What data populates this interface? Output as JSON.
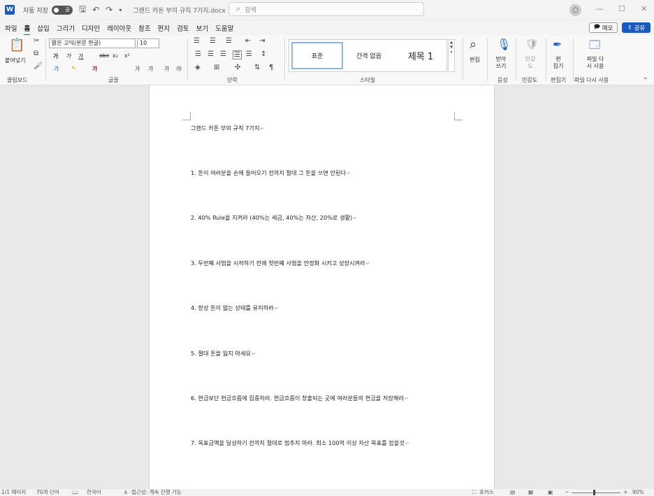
{
  "titlebar": {
    "autosave_label": "자동 저장",
    "autosave_state": "끔",
    "document_name": "그랜드 카돈 부의 규칙 7가지.docx",
    "search_placeholder": "검색",
    "minimize": "—",
    "maximize": "☐",
    "close": "✕"
  },
  "menu": {
    "items": [
      "파일",
      "홈",
      "삽입",
      "그리기",
      "디자인",
      "레이아웃",
      "참조",
      "편지",
      "검토",
      "보기",
      "도움말"
    ],
    "memo_label": "메모",
    "share_label": "공유"
  },
  "ribbon": {
    "paste_label": "붙여넣기",
    "font_name": "맑은 고딕(본문 한글)",
    "font_size": "10",
    "styles": [
      "표준",
      "간격 없음",
      "제목 1"
    ],
    "edit_label": "편집",
    "dictate_label": "받아 쓰기",
    "sensitivity_label": "민감 도",
    "editor_label": "편 집기",
    "reuse_label": "파일 다 시 사용",
    "group_labels": {
      "clipboard": "클립보드",
      "font": "글꼴",
      "paragraph": "단락",
      "styles": "스타일",
      "voice": "음성",
      "sensitivity": "민감도",
      "editor": "편집기",
      "reuse": "파일 다시 사용"
    }
  },
  "document": {
    "title": "그랜드 카돈 부의 규칙 7가지",
    "rules": [
      "1. 돈이 여러분을 손에 들어오기 전까지 절대 그 돈을 쓰면 안된다",
      "2. 40% Rule을 지켜라 (40%는 세금, 40%는 자산, 20%로 생활)",
      "3. 두번째 사업을 시작하기 전에 첫번째 사업을 안정화 시키고 성장시켜라",
      "4. 항상 돈이 없는 상태를 유지하라",
      "5. 절대 돈을 잃지 마세요",
      "6. 현금보단 현금흐름에 집중하라. 현금흐름이 창출되는 곳에 여러분들의 현금을 저장해라",
      "7. 목표금액을 달성하기 전까지 절대로 멈추지 마라. 최소 100억 이상 자산 목표를 잡을것"
    ]
  },
  "statusbar": {
    "page": "1/1 페이지",
    "words": "70개 단어",
    "language": "한국어",
    "accessibility": "접근성: 계속 진행 가능",
    "focus": "포커스",
    "zoom": "90%"
  },
  "colors": {
    "accent": "#185abd"
  }
}
